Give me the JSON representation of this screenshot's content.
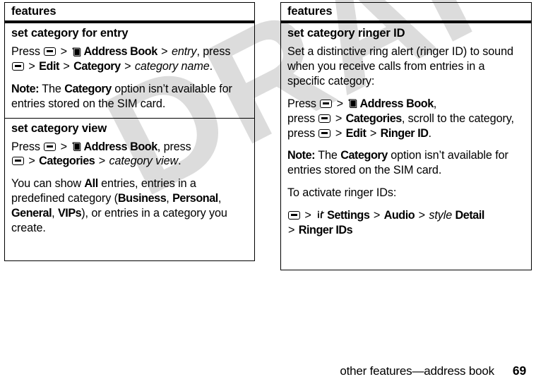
{
  "document": {
    "watermark": "DRAFT",
    "footer": {
      "running_head": "other features—address book",
      "page_number": "69"
    }
  },
  "icons": {
    "menu_key": "menu-key-icon",
    "address_book": "address-book-icon",
    "settings": "settings-tools-icon"
  },
  "tables": {
    "left": {
      "header": "features",
      "rows": [
        {
          "title": "set category for entry",
          "paragraphs": {
            "p1": {
              "t1": "Press ",
              "t2": " > ",
              "t3": "Address Book",
              "t4": " > ",
              "t5": "entry",
              "t6": ", press ",
              "t7": " > ",
              "t8": "Edit",
              "t9": " > ",
              "t10": "Category",
              "t11": " > ",
              "t12": "category name",
              "t13": "."
            },
            "p2": {
              "t1": "Note:",
              "t2": " The ",
              "t3": "Category",
              "t4": " option isn’t available for entries stored on the SIM card."
            }
          }
        },
        {
          "title": "set category view",
          "paragraphs": {
            "p1": {
              "t1": "Press ",
              "t2": " > ",
              "t3": "Address Book",
              "t4": ", press ",
              "t5": " > ",
              "t6": "Categories",
              "t7": " > ",
              "t8": "category view",
              "t9": "."
            },
            "p2": {
              "t1": "You can show ",
              "t2": "All",
              "t3": " entries, entries in a predefined category (",
              "t4": "Business",
              "t5": ", ",
              "t6": "Personal",
              "t7": ", ",
              "t8": "General",
              "t9": ", ",
              "t10": "VIPs",
              "t11": "), or entries in a category you create."
            }
          }
        }
      ]
    },
    "right": {
      "header": "features",
      "rows": [
        {
          "title": "set category ringer ID",
          "paragraphs": {
            "p1": {
              "t1": "Set a distinctive ring alert (ringer ID) to sound when you receive calls from entries in a specific category:"
            },
            "p2": {
              "t1": "Press ",
              "t2": " > ",
              "t3": "Address Book",
              "t4": ",",
              "t5": "press ",
              "t6": " > ",
              "t7": "Categories",
              "t8": ", scroll to the category, ",
              "t9": "press ",
              "t10": " > ",
              "t11": "Edit",
              "t12": " > ",
              "t13": "Ringer ID",
              "t14": "."
            },
            "p3": {
              "t1": "Note:",
              "t2": " The ",
              "t3": "Category",
              "t4": " option isn’t available for entries stored on the SIM card."
            },
            "p4": {
              "t1": "To activate ringer IDs:"
            },
            "p5": {
              "t1": " > ",
              "t2": "Settings",
              "t3": " > ",
              "t4": "Audio",
              "t5": " > ",
              "t6": "style",
              "t7": " ",
              "t8": "Detail",
              "t9": " > ",
              "t10": "Ringer IDs"
            }
          }
        }
      ]
    }
  }
}
